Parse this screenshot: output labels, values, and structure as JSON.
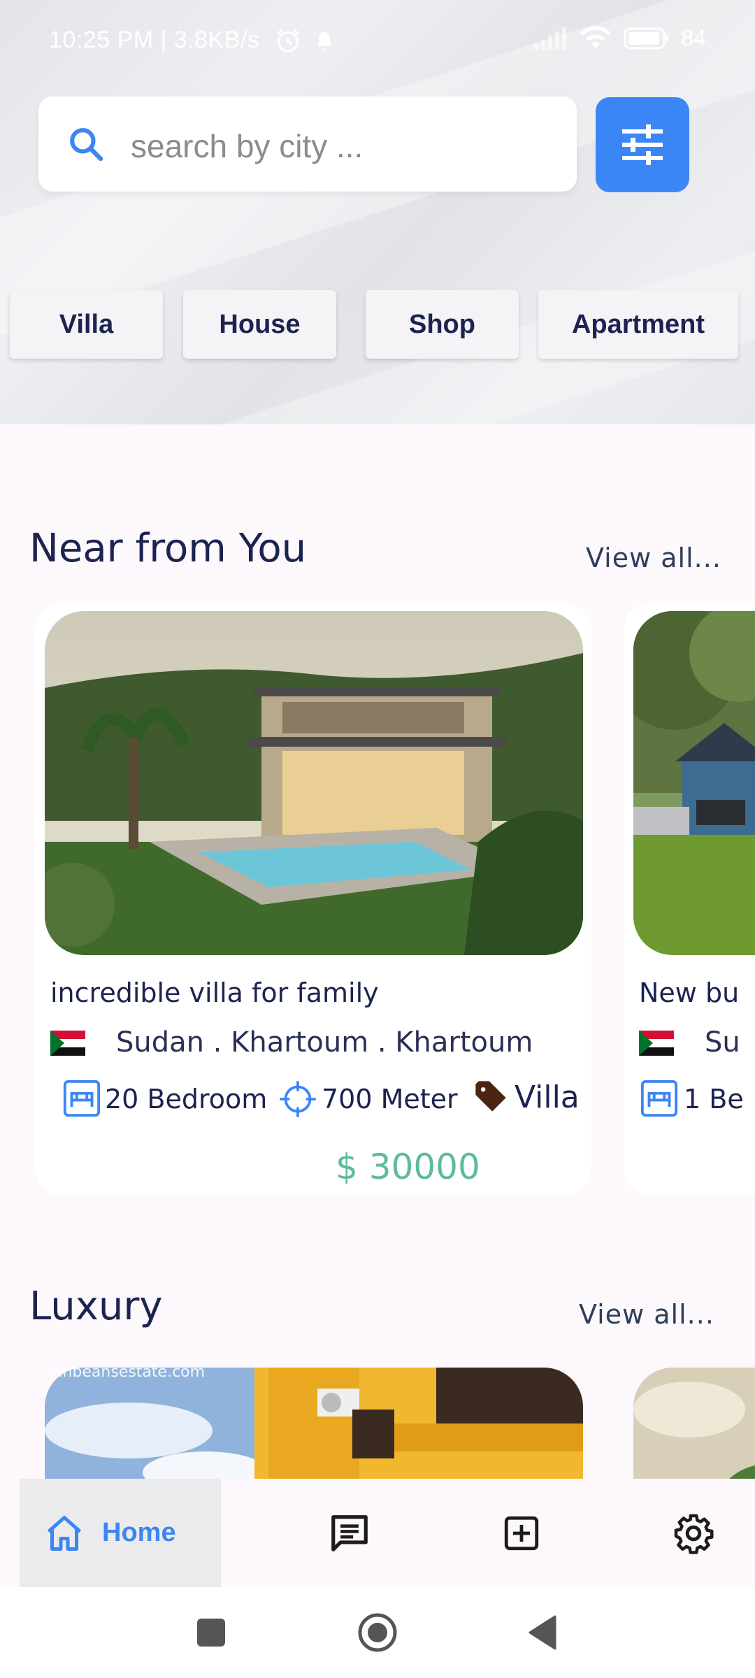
{
  "status_bar": {
    "text": "10:25 PM | 3.8KB/s",
    "battery": "84"
  },
  "search": {
    "placeholder": "search by city ..."
  },
  "categories": [
    "Villa",
    "House",
    "Shop",
    "Apartment"
  ],
  "sections": {
    "near": {
      "title": "Near from You",
      "view_all": "View all..."
    },
    "luxury": {
      "title": "Luxury",
      "view_all": "View all..."
    }
  },
  "near_cards": [
    {
      "title": "incredible villa for family",
      "location": "Sudan .  Khartoum .  Khartoum",
      "bedrooms": "20 Bedroom",
      "area": "700 Meter",
      "type": "Villa",
      "price": "$ 30000"
    },
    {
      "title": "New bu",
      "location": "Su",
      "bedrooms": "1 Be"
    }
  ],
  "luxury_cards": [
    {
      "watermark": "anbeansestate.com"
    }
  ],
  "bottom_nav": {
    "home": "Home"
  },
  "colors": {
    "accent": "#3b86f5",
    "price": "#5cbaa0",
    "text_dark": "#1c2350",
    "background": "#fdf8fc"
  },
  "icons": [
    "search-icon",
    "filter-sliders-icon",
    "bed-icon",
    "crosshair-icon",
    "tag-icon",
    "home-icon",
    "message-icon",
    "add-box-icon",
    "settings-gear-icon"
  ]
}
